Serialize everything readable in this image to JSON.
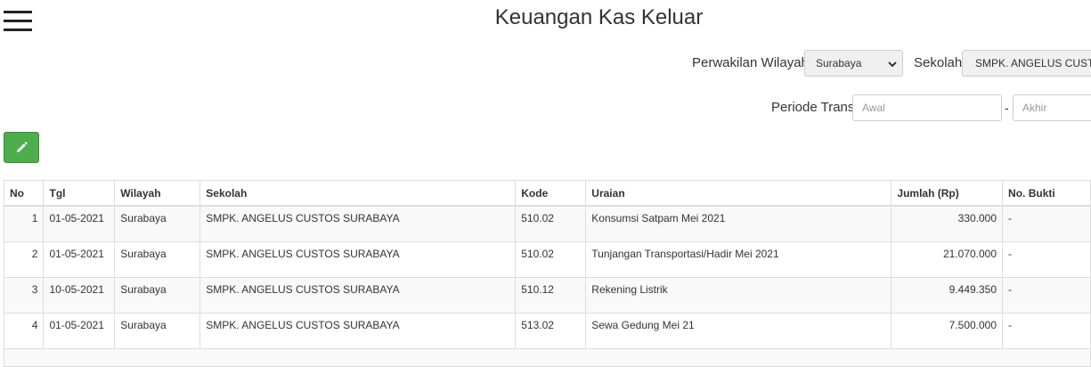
{
  "header": {
    "title": "Keuangan Kas Keluar",
    "menu_icon": "hamburger-menu-icon"
  },
  "filters": {
    "wilayah_label": "Perwakilan Wilayah",
    "wilayah_value": "Surabaya",
    "sekolah_label": "Sekolah",
    "sekolah_value": "SMPK. ANGELUS CUSTOS SURABAYA",
    "periode_label": "Periode Trans",
    "awal_placeholder": "Awal",
    "separator": "-",
    "akhir_placeholder": "Akhir"
  },
  "toolbar": {
    "edit_icon": "pencil-icon",
    "edit_color": "#4cae4c"
  },
  "table": {
    "headers": [
      "No",
      "Tgl",
      "Wilayah",
      "Sekolah",
      "Kode",
      "Uraian",
      "Jumlah (Rp)",
      "No. Bukti"
    ],
    "rows": [
      [
        "1",
        "01-05-2021",
        "Surabaya",
        "SMPK. ANGELUS CUSTOS SURABAYA",
        "510.02",
        "Konsumsi Satpam Mei 2021",
        "330.000",
        "-"
      ],
      [
        "2",
        "01-05-2021",
        "Surabaya",
        "SMPK. ANGELUS CUSTOS SURABAYA",
        "510.02",
        "Tunjangan Transportasi/Hadir Mei 2021",
        "21.070.000",
        "-"
      ],
      [
        "3",
        "10-05-2021",
        "Surabaya",
        "SMPK. ANGELUS CUSTOS SURABAYA",
        "510.12",
        "Rekening Listrik",
        "9.449.350",
        "-"
      ],
      [
        "4",
        "01-05-2021",
        "Surabaya",
        "SMPK. ANGELUS CUSTOS SURABAYA",
        "513.02",
        "Sewa Gedung Mei 21",
        "7.500.000",
        "-"
      ]
    ]
  }
}
